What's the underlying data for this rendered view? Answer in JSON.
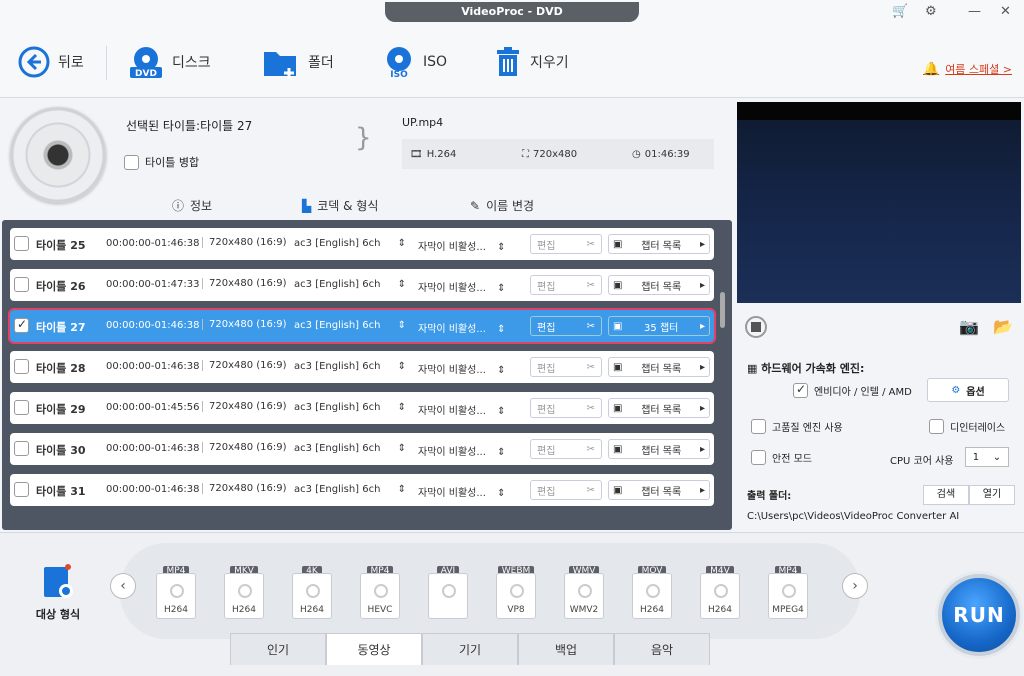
{
  "window": {
    "title": "VideoProc - DVD"
  },
  "toolbar": {
    "back": "뒤로",
    "disc": "디스크",
    "folder": "폴더",
    "iso": "ISO",
    "delete": "지우기",
    "promo": "여름 스페셜 >"
  },
  "info": {
    "selected_title": "선택된 타이틀:타이틀 27",
    "merge_label": "타이틀 병합",
    "output_file": "UP.mp4",
    "codec": "H.264",
    "resolution": "720x480",
    "duration": "01:46:39"
  },
  "info_tabs": {
    "info": "정보",
    "codec_format": "코덱 & 형식",
    "rename": "이름 변경"
  },
  "titles": [
    {
      "name": "타이틀 25",
      "dur": "00:00:00-01:46:38",
      "res": "720x480 (16:9)",
      "audio": "ac3 [English] 6ch",
      "sub": "자막이 비활성...",
      "edit": "편집",
      "chap": "챕터 목록",
      "checked": false,
      "selected": false
    },
    {
      "name": "타이틀 26",
      "dur": "00:00:00-01:47:33",
      "res": "720x480 (16:9)",
      "audio": "ac3 [English] 6ch",
      "sub": "자막이 비활성...",
      "edit": "편집",
      "chap": "챕터 목록",
      "checked": false,
      "selected": false
    },
    {
      "name": "타이틀 27",
      "dur": "00:00:00-01:46:38",
      "res": "720x480 (16:9)",
      "audio": "ac3 [English] 6ch",
      "sub": "자막이 비활성...",
      "edit": "편집",
      "chap": "35 챕터",
      "checked": true,
      "selected": true
    },
    {
      "name": "타이틀 28",
      "dur": "00:00:00-01:46:38",
      "res": "720x480 (16:9)",
      "audio": "ac3 [English] 6ch",
      "sub": "자막이 비활성...",
      "edit": "편집",
      "chap": "챕터 목록",
      "checked": false,
      "selected": false
    },
    {
      "name": "타이틀 29",
      "dur": "00:00:00-01:45:56",
      "res": "720x480 (16:9)",
      "audio": "ac3 [English] 6ch",
      "sub": "자막이 비활성...",
      "edit": "편집",
      "chap": "챕터 목록",
      "checked": false,
      "selected": false
    },
    {
      "name": "타이틀 30",
      "dur": "00:00:00-01:46:38",
      "res": "720x480 (16:9)",
      "audio": "ac3 [English] 6ch",
      "sub": "자막이 비활성...",
      "edit": "편집",
      "chap": "챕터 목록",
      "checked": false,
      "selected": false
    },
    {
      "name": "타이틀 31",
      "dur": "00:00:00-01:46:38",
      "res": "720x480 (16:9)",
      "audio": "ac3 [English] 6ch",
      "sub": "자막이 비활성...",
      "edit": "편집",
      "chap": "챕터 목록",
      "checked": false,
      "selected": false
    }
  ],
  "hw": {
    "title": "하드웨어 가속화 엔진:",
    "nvidia": "엔비디아 / 인텔 / AMD",
    "option": "옵션",
    "hq": "고품질 엔진 사용",
    "deint": "디인터레이스",
    "safe": "안전 모드",
    "cpu": "CPU 코어 사용",
    "cpu_val": "1",
    "out_label": "출력 폴더:",
    "browse": "검색",
    "open": "열기",
    "path": "C:\\Users\\pc\\Videos\\VideoProc Converter AI"
  },
  "target_label": "대상 형식",
  "formats": [
    {
      "tag": "MP4",
      "lab": "H264"
    },
    {
      "tag": "MKV",
      "lab": "H264"
    },
    {
      "tag": "4K",
      "lab": "H264"
    },
    {
      "tag": "MP4",
      "lab": "HEVC"
    },
    {
      "tag": "AVI",
      "lab": ""
    },
    {
      "tag": "WEBM",
      "lab": "VP8"
    },
    {
      "tag": "WMV",
      "lab": "WMV2"
    },
    {
      "tag": "MOV",
      "lab": "H264"
    },
    {
      "tag": "M4V",
      "lab": "H264"
    },
    {
      "tag": "MP4",
      "lab": "MPEG4"
    }
  ],
  "bottom_tabs": [
    "인기",
    "동영상",
    "기기",
    "백업",
    "음악"
  ],
  "run": "RUN",
  "colors": {
    "accent": "#3d9ae8",
    "selected_outline": "#e04366",
    "brand_blue": "#1a73d9"
  }
}
